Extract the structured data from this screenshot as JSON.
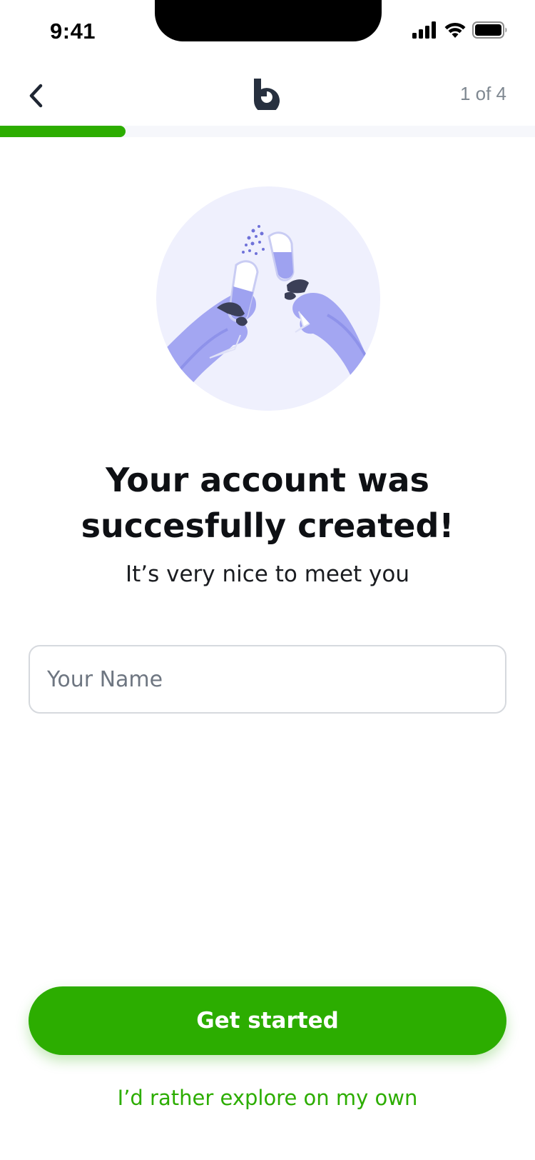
{
  "status_bar": {
    "time": "9:41",
    "icons": [
      "cellular-signal-icon",
      "wifi-icon",
      "battery-icon"
    ]
  },
  "header": {
    "back_icon": "chevron-left-icon",
    "logo": "brand-logo",
    "step_counter": "1 of 4"
  },
  "progress": {
    "value": 0.235,
    "colors": {
      "fill": "#2cad00",
      "track": "#f6f7fb"
    }
  },
  "illustration": {
    "name": "toasting-glasses-illustration"
  },
  "content": {
    "headline": "Your account was succesfully created!",
    "subtitle": "It’s very nice to meet you"
  },
  "name_input": {
    "value": "",
    "placeholder": "Your Name"
  },
  "actions": {
    "primary_label": "Get started",
    "secondary_label": "I’d rather explore on my own"
  },
  "colors": {
    "accent": "#2cad00",
    "text_primary": "#0e1014",
    "text_muted": "#7f8891",
    "illustration_bg": "#eff0fd",
    "illustration_hand": "#a3a6f2"
  }
}
